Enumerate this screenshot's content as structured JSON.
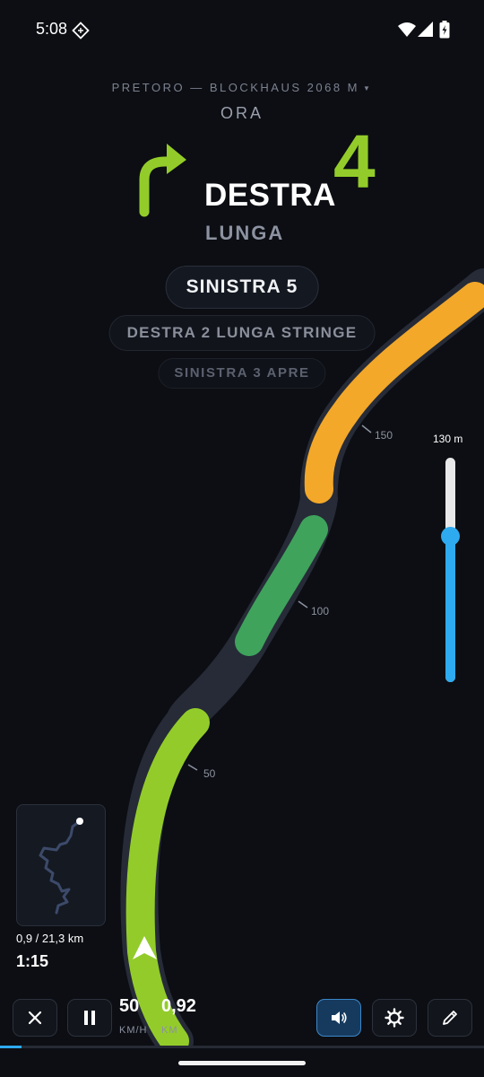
{
  "status_bar": {
    "time": "5:08"
  },
  "route": {
    "name": "PRETORO — BLOCKHAUS 2068 M",
    "now_label": "ORA"
  },
  "current_note": {
    "direction": "DESTRA",
    "modifier": "LUNGA",
    "grade": "4",
    "grade_color": "#93cc2a"
  },
  "upcoming": [
    {
      "text": "SINISTRA 5"
    },
    {
      "text": "DESTRA 2 LUNGA STRINGE"
    },
    {
      "text": "SINISTRA 3 APRE"
    }
  ],
  "road_markers": [
    "150",
    "100",
    "50"
  ],
  "zoom": {
    "label": "130 m",
    "level_fraction": 0.65
  },
  "trip": {
    "distance": "0,9 / 21,3 km",
    "elapsed": "1:15",
    "progress_fraction": 0.045
  },
  "speed": {
    "value": "50",
    "unit": "KM/H"
  },
  "odometer": {
    "value": "0,92",
    "unit": "KM"
  },
  "colors": {
    "accent": "#2eaaf0",
    "green": "#93cc2a",
    "dark_green": "#3fa35c",
    "orange": "#f3a82a"
  },
  "buttons": {
    "close": "close-icon",
    "pause": "pause-icon",
    "sound": "speaker-icon",
    "settings": "gear-icon",
    "edit": "pencil-icon"
  }
}
